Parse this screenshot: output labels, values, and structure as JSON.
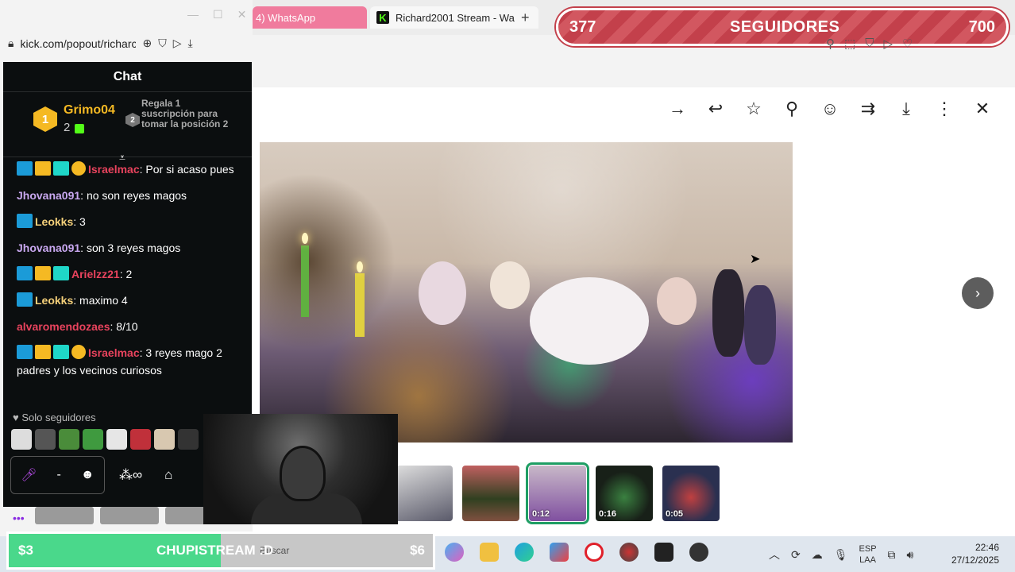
{
  "browser": {
    "tab_whatsapp": "4) WhatsApp",
    "tab_kick": "Richard2001 Stream - Wa",
    "new_tab": "+"
  },
  "followers_widget": {
    "current": "377",
    "label": "SEGUIDORES",
    "goal": "700"
  },
  "chat_window": {
    "url": "kick.com/popout/richarc",
    "header": "Chat",
    "leaderboard": {
      "rank": "1",
      "name": "Grimo04",
      "count": "2",
      "next_rank": "2",
      "prompt": "Regala 1 suscripción para tomar la posición 2"
    },
    "messages": [
      {
        "user": "Israelmac",
        "user_color": "#e8435d",
        "badges": [
          "mod",
          "vip",
          "og",
          "sub"
        ],
        "text": ": Por si acaso pues"
      },
      {
        "user": "Jhovana091",
        "user_color": "#c9a8f0",
        "badges": [],
        "text": ": no son reyes magos"
      },
      {
        "user": "Leokks",
        "user_color": "#f5d07a",
        "badges": [
          "mod"
        ],
        "text": ": 3"
      },
      {
        "user": "Jhovana091",
        "user_color": "#c9a8f0",
        "badges": [],
        "text": ": son 3 reyes magos"
      },
      {
        "user": "Arielzz21",
        "user_color": "#e8435d",
        "badges": [
          "mod",
          "vip",
          "og"
        ],
        "text": ": 2"
      },
      {
        "user": "Leokks",
        "user_color": "#f5d07a",
        "badges": [
          "mod"
        ],
        "text": ": maximo 4"
      },
      {
        "user": "alvaromendozaes",
        "user_color": "#e8435d",
        "badges": [],
        "text": ": 8/10"
      },
      {
        "user": "Israelmac",
        "user_color": "#e8435d",
        "badges": [
          "mod",
          "vip",
          "og",
          "sub"
        ],
        "text": ": 3 reyes mago 2 padres y los vecinos curiosos"
      }
    ],
    "mode": "Solo seguidores",
    "separator": "-"
  },
  "viewer": {
    "thumbnails": [
      {
        "duration": ""
      },
      {
        "duration": ""
      },
      {
        "duration": "0:12"
      },
      {
        "duration": "0:16"
      },
      {
        "duration": "0:05"
      }
    ]
  },
  "donation_widget": {
    "current": "$3",
    "title": "CHUPISTREAM :D",
    "goal": "$6",
    "search_placeholder": "Buscar",
    "progress": 0.5
  },
  "taskbar": {
    "lang_top": "ESP",
    "lang_bottom": "LAA",
    "time": "22:46",
    "date": "27/12/2025"
  },
  "icons": [
    "minimize-icon",
    "maximize-icon",
    "close-icon",
    "lock-icon",
    "zoom-icon",
    "shield-icon",
    "share-icon",
    "download-icon",
    "forward-icon",
    "reply-icon",
    "star-icon",
    "pin-icon",
    "emoji-icon",
    "forward-all-icon",
    "more-icon",
    "chevron-right-icon",
    "mic-icon",
    "store-icon",
    "infinity-icon"
  ]
}
